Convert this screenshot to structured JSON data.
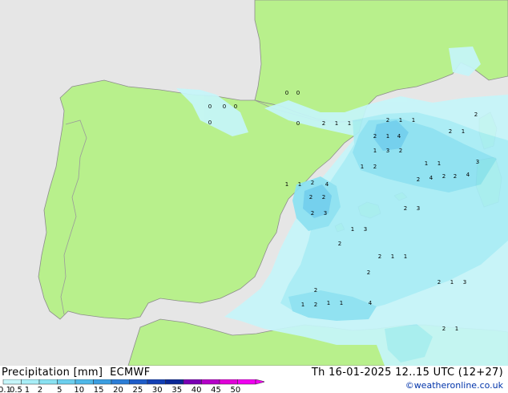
{
  "legend": {
    "title": "Precipitation [mm]",
    "model": "ECMWF",
    "valid_time": "Th 16-01-2025 12..15 UTC (12+27)",
    "credit": "©weatheronline.co.uk",
    "scale_labels": [
      "0.1",
      "0.5",
      "1",
      "2",
      "5",
      "10",
      "15",
      "20",
      "25",
      "30",
      "35",
      "40",
      "45",
      "50"
    ],
    "scale_colors": [
      "#c6f6fa",
      "#a8eef7",
      "#8ae2f2",
      "#6ccfee",
      "#4fb8e8",
      "#3a9de0",
      "#2b7dd6",
      "#1e5cc8",
      "#123fb4",
      "#0a2796",
      "#7a00b4",
      "#b400c8",
      "#e000d8",
      "#f000f0"
    ]
  },
  "colors": {
    "land": "#b8f08c",
    "sea": "#e6e6e6",
    "border": "#9a9a9a",
    "coast": "#8c8c8c"
  },
  "map_labels": [
    {
      "id": "n01",
      "text": "0"
    },
    {
      "id": "n02",
      "text": "0"
    },
    {
      "id": "n03",
      "text": "0"
    },
    {
      "id": "n04",
      "text": "0"
    },
    {
      "id": "n05",
      "text": "0"
    },
    {
      "id": "n06",
      "text": "0"
    },
    {
      "id": "n07",
      "text": "0"
    },
    {
      "id": "n08",
      "text": "2"
    },
    {
      "id": "n09",
      "text": "1"
    },
    {
      "id": "n10",
      "text": "1"
    },
    {
      "id": "n11",
      "text": "2"
    },
    {
      "id": "n12",
      "text": "1"
    },
    {
      "id": "n13",
      "text": "1"
    },
    {
      "id": "n14",
      "text": "2"
    },
    {
      "id": "n15",
      "text": "1"
    },
    {
      "id": "n16",
      "text": "4"
    },
    {
      "id": "n17",
      "text": "3"
    },
    {
      "id": "n18",
      "text": "2"
    },
    {
      "id": "n19",
      "text": "1"
    },
    {
      "id": "n20",
      "text": "2"
    },
    {
      "id": "n21",
      "text": "1"
    },
    {
      "id": "n22",
      "text": "2"
    },
    {
      "id": "n23",
      "text": "1"
    },
    {
      "id": "n24",
      "text": "1"
    },
    {
      "id": "n25",
      "text": "3"
    },
    {
      "id": "n26",
      "text": "2"
    },
    {
      "id": "n27",
      "text": "1"
    },
    {
      "id": "n28",
      "text": "2"
    },
    {
      "id": "n29",
      "text": "4"
    },
    {
      "id": "n30",
      "text": "2"
    },
    {
      "id": "n31",
      "text": "4"
    },
    {
      "id": "n32",
      "text": "2"
    },
    {
      "id": "n33",
      "text": "1"
    },
    {
      "id": "n34",
      "text": "2"
    },
    {
      "id": "n35",
      "text": "2"
    },
    {
      "id": "n36",
      "text": "2"
    },
    {
      "id": "n37",
      "text": "4"
    },
    {
      "id": "n38",
      "text": "3"
    },
    {
      "id": "n39",
      "text": "1"
    },
    {
      "id": "n40",
      "text": "2"
    },
    {
      "id": "n41",
      "text": "3"
    },
    {
      "id": "n42",
      "text": "2"
    },
    {
      "id": "n43",
      "text": "1"
    },
    {
      "id": "n44",
      "text": "2"
    },
    {
      "id": "n45",
      "text": "3"
    },
    {
      "id": "n46",
      "text": "1"
    },
    {
      "id": "n47",
      "text": "2"
    },
    {
      "id": "n48",
      "text": "1"
    },
    {
      "id": "n49",
      "text": "2"
    },
    {
      "id": "n50",
      "text": "2"
    },
    {
      "id": "n51",
      "text": "4"
    },
    {
      "id": "n52",
      "text": "1"
    },
    {
      "id": "n53",
      "text": "1"
    },
    {
      "id": "n54",
      "text": "2"
    },
    {
      "id": "n55",
      "text": "1"
    },
    {
      "id": "n56",
      "text": "3"
    },
    {
      "id": "n57",
      "text": "1"
    },
    {
      "id": "n58",
      "text": "2"
    },
    {
      "id": "n59",
      "text": "1"
    },
    {
      "id": "n60",
      "text": "2"
    }
  ]
}
